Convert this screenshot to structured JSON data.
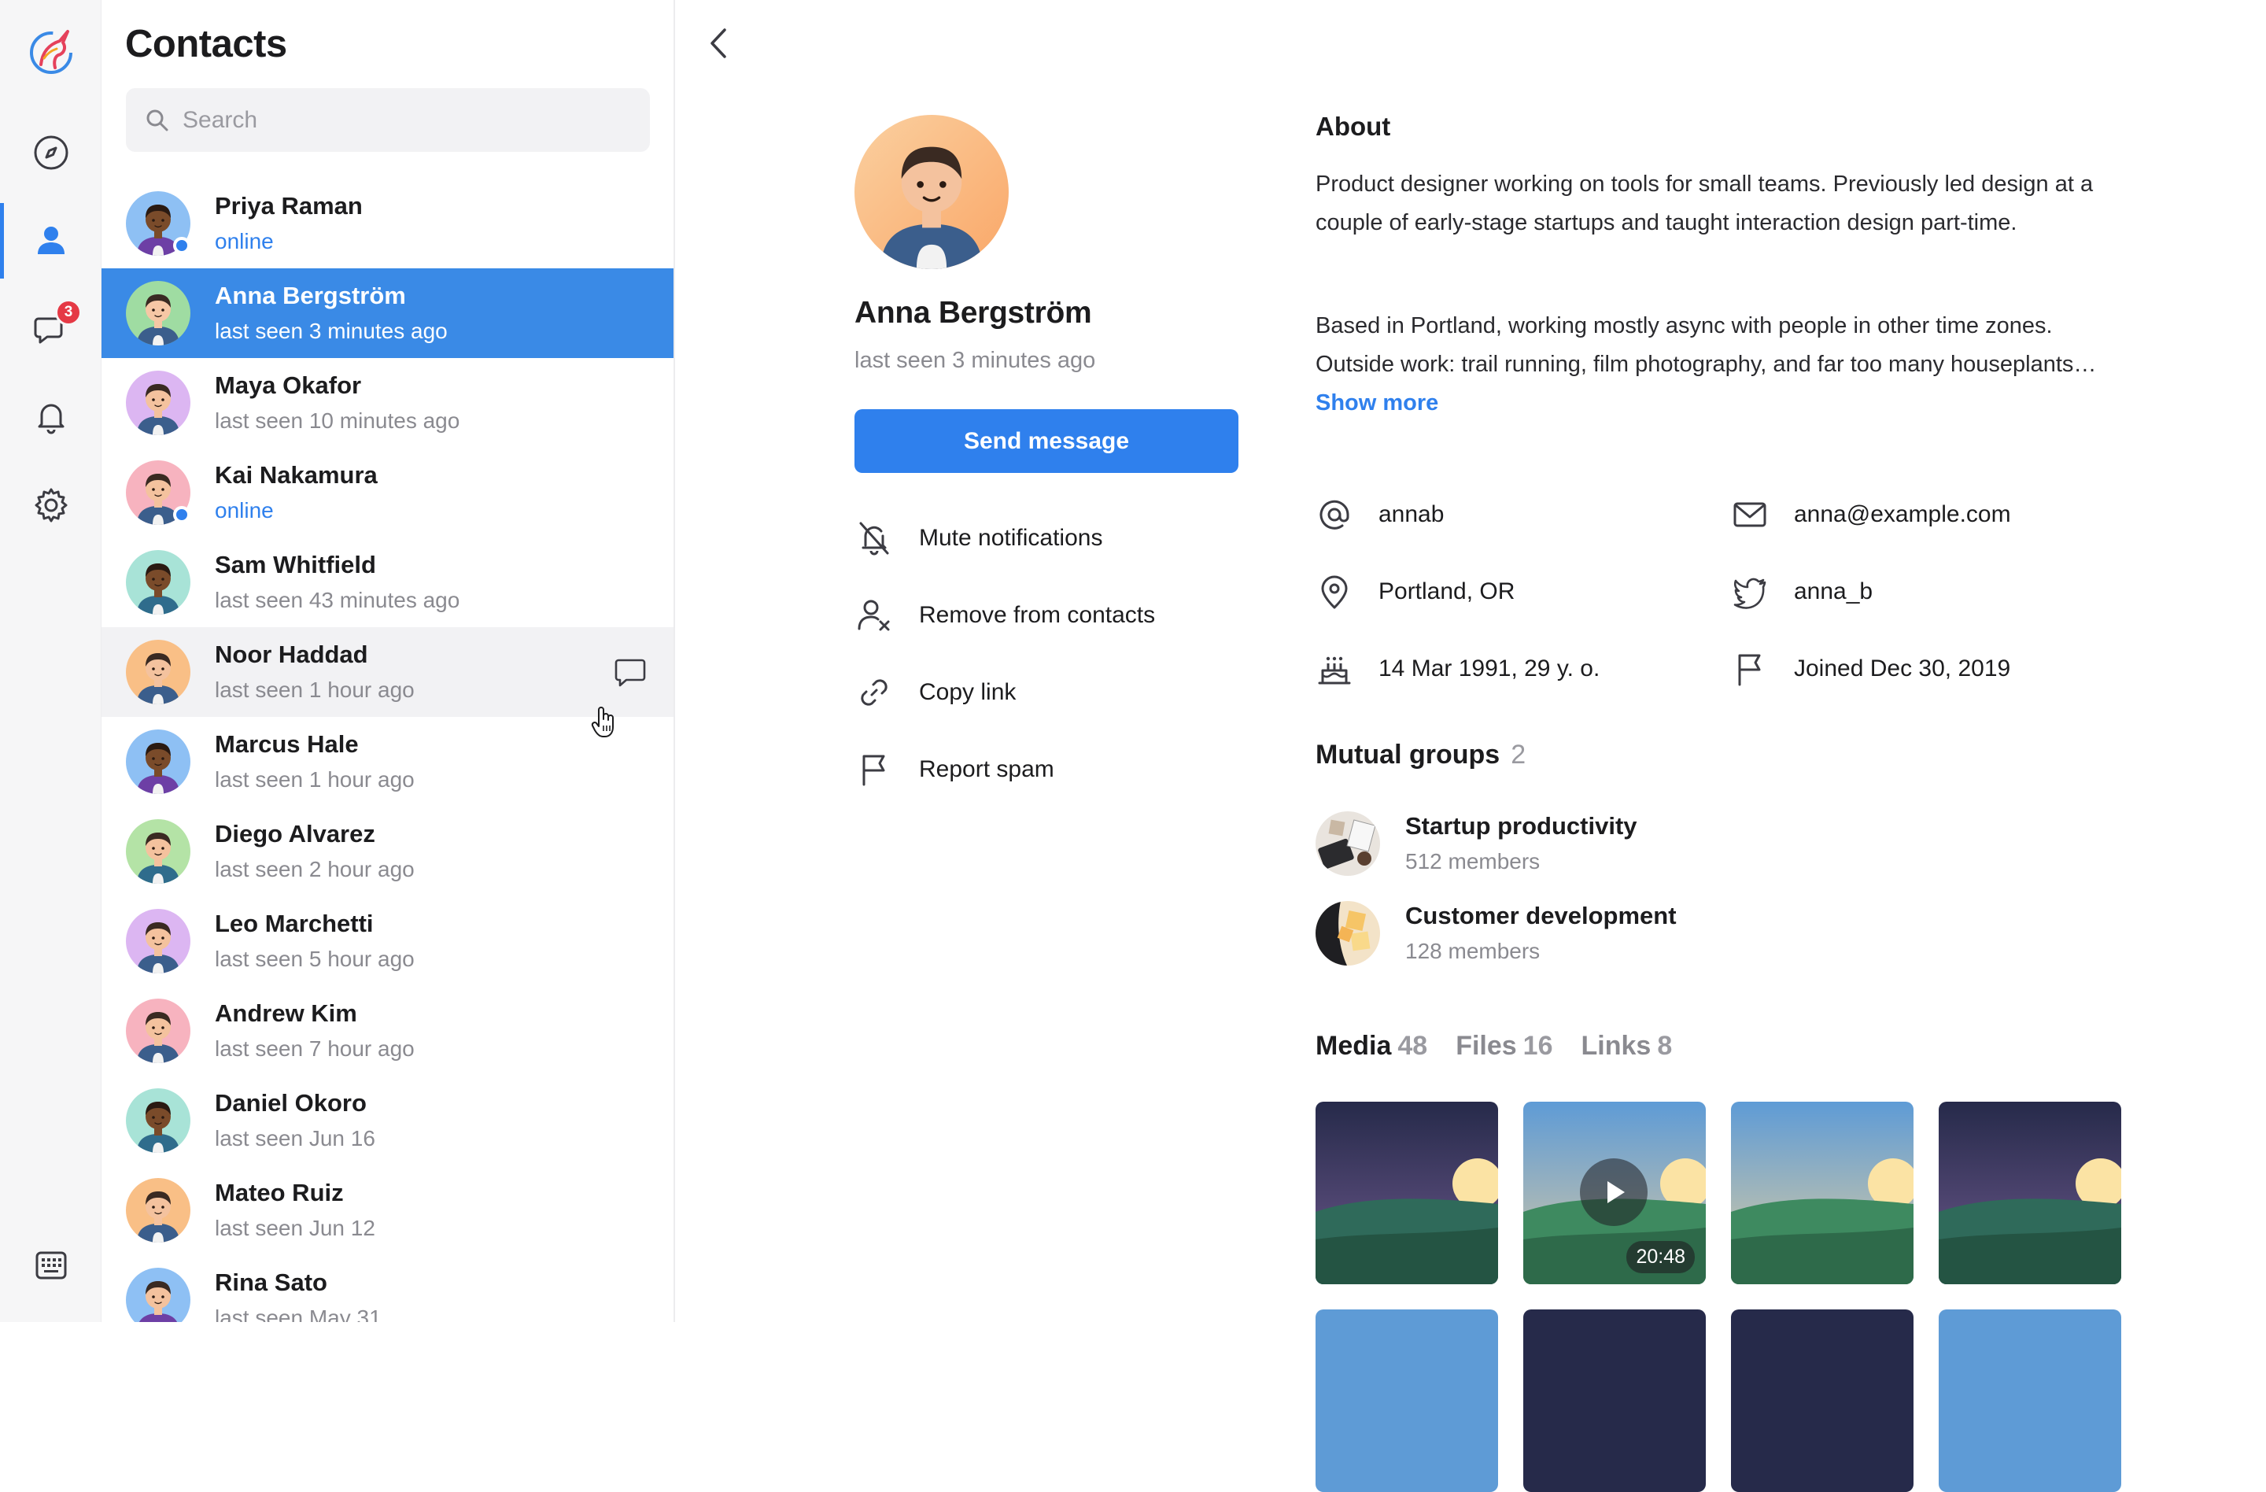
{
  "rail": {
    "chat_badge": "3"
  },
  "contacts": {
    "title": "Contacts",
    "search_placeholder": "Search",
    "items": [
      {
        "name": "Priya Raman",
        "status": "online",
        "online": true,
        "bg": "#8ec0f4",
        "skin": "#7a4b2a",
        "hair": "#2a1a12",
        "shirt": "#6d3fa5"
      },
      {
        "name": "Anna Bergström",
        "status": "last seen 3 minutes ago",
        "online": false,
        "bg": "#9fdca2",
        "skin": "#f6c7a5",
        "hair": "#3a2a22",
        "shirt": "#3b5e8c"
      },
      {
        "name": "Maya Okafor",
        "status": "last seen 10 minutes ago",
        "online": false,
        "bg": "#dcb6f2",
        "skin": "#f4c29e",
        "hair": "#3a2a22",
        "shirt": "#3b5e8c"
      },
      {
        "name": "Kai Nakamura",
        "status": "online",
        "online": true,
        "bg": "#f7b3bf",
        "skin": "#f4c29e",
        "hair": "#3a2a22",
        "shirt": "#3b5e8c"
      },
      {
        "name": "Sam Whitfield",
        "status": "last seen 43 minutes ago",
        "online": false,
        "bg": "#a8e3d7",
        "skin": "#7a4b2a",
        "hair": "#2a1a12",
        "shirt": "#2f6c8c"
      },
      {
        "name": "Noor Haddad",
        "status": "last seen 1 hour ago",
        "online": false,
        "bg": "#f9bf86",
        "skin": "#f4c29e",
        "hair": "#3a2a22",
        "shirt": "#3b5e8c"
      },
      {
        "name": "Marcus Hale",
        "status": "last seen 1 hour ago",
        "online": false,
        "bg": "#8ec0f4",
        "skin": "#7a4b2a",
        "hair": "#2a1a12",
        "shirt": "#6d3fa5"
      },
      {
        "name": "Diego Alvarez",
        "status": "last seen 2 hour ago",
        "online": false,
        "bg": "#b4e3a6",
        "skin": "#f4c29e",
        "hair": "#3a2a22",
        "shirt": "#2f6c8c"
      },
      {
        "name": "Leo Marchetti",
        "status": "last seen 5 hour ago",
        "online": false,
        "bg": "#dcb6f2",
        "skin": "#f4c29e",
        "hair": "#3a2a22",
        "shirt": "#3b5e8c"
      },
      {
        "name": "Andrew Kim",
        "status": "last seen 7 hour ago",
        "online": false,
        "bg": "#f7b3bf",
        "skin": "#f4c29e",
        "hair": "#3a2a22",
        "shirt": "#3b5e8c"
      },
      {
        "name": "Daniel Okoro",
        "status": "last seen Jun 16",
        "online": false,
        "bg": "#a8e3d7",
        "skin": "#7a4b2a",
        "hair": "#2a1a12",
        "shirt": "#2f6c8c"
      },
      {
        "name": "Mateo Ruiz",
        "status": "last seen Jun 12",
        "online": false,
        "bg": "#f9bf86",
        "skin": "#f4c29e",
        "hair": "#3a2a22",
        "shirt": "#3b5e8c"
      },
      {
        "name": "Rina Sato",
        "status": "last seen May 31",
        "online": false,
        "bg": "#8ec0f4",
        "skin": "#f4c29e",
        "hair": "#3a2a22",
        "shirt": "#6d3fa5"
      }
    ]
  },
  "profile": {
    "name": "Anna Bergström",
    "status": "last seen 3 minutes ago",
    "send_label": "Send message",
    "actions": {
      "mute": "Mute notifications",
      "remove": "Remove from contacts",
      "copy": "Copy link",
      "spam": "Report spam"
    },
    "about_heading": "About",
    "bio_p1": "Product designer working on tools for small teams. Previously led design at a couple of early-stage startups and taught interaction design part-time.",
    "bio_p2": "Based in Portland, working mostly async with people in other time zones. Outside work: trail running, film photography, and far too many houseplants…",
    "show_more": "Show more",
    "info": {
      "username": "annab",
      "email": "anna@example.com",
      "location": "Portland, OR",
      "twitter": "anna_b",
      "birthday": "14 Mar 1991, 29 y. o.",
      "joined": "Joined Dec 30, 2019"
    },
    "groups_heading": "Mutual groups",
    "groups_count": "2",
    "groups": [
      {
        "name": "Startup productivity",
        "members": "512 members"
      },
      {
        "name": "Customer development",
        "members": "128 members"
      }
    ],
    "tabs": [
      {
        "label": "Media",
        "count": "48"
      },
      {
        "label": "Files",
        "count": "16"
      },
      {
        "label": "Links",
        "count": "8"
      }
    ],
    "video_duration": "20:48"
  },
  "colors": {
    "accent": "#2f80ed",
    "selected_row": "#3a8ae6",
    "badge": "#e53945"
  }
}
